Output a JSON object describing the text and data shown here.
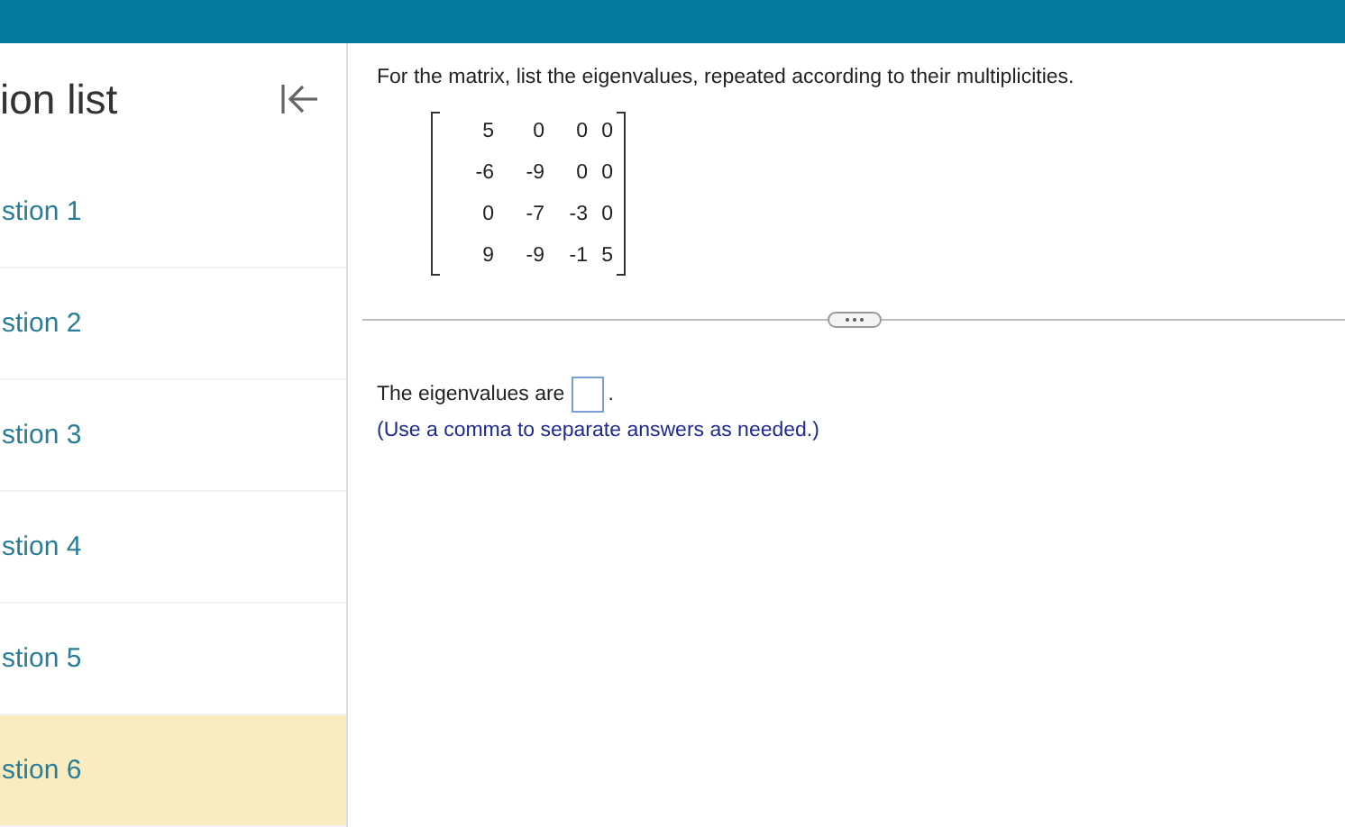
{
  "sidebar": {
    "title": "ion list",
    "items": [
      {
        "label": "stion 1",
        "selected": false
      },
      {
        "label": "stion 2",
        "selected": false
      },
      {
        "label": "stion 3",
        "selected": false
      },
      {
        "label": "stion 4",
        "selected": false
      },
      {
        "label": "stion 5",
        "selected": false
      },
      {
        "label": "stion 6",
        "selected": true
      }
    ]
  },
  "question": {
    "prompt": "For the matrix, list the eigenvalues, repeated according to their multiplicities.",
    "matrix": [
      [
        "5",
        "0",
        "0",
        "0"
      ],
      [
        "-6",
        "-9",
        "0",
        "0"
      ],
      [
        "0",
        "-7",
        "-3",
        "0"
      ],
      [
        "9",
        "-9",
        "-1",
        "5"
      ]
    ],
    "answer_label": "The eigenvalues are",
    "answer_end": ".",
    "hint": "(Use a comma to separate answers as needed.)"
  }
}
